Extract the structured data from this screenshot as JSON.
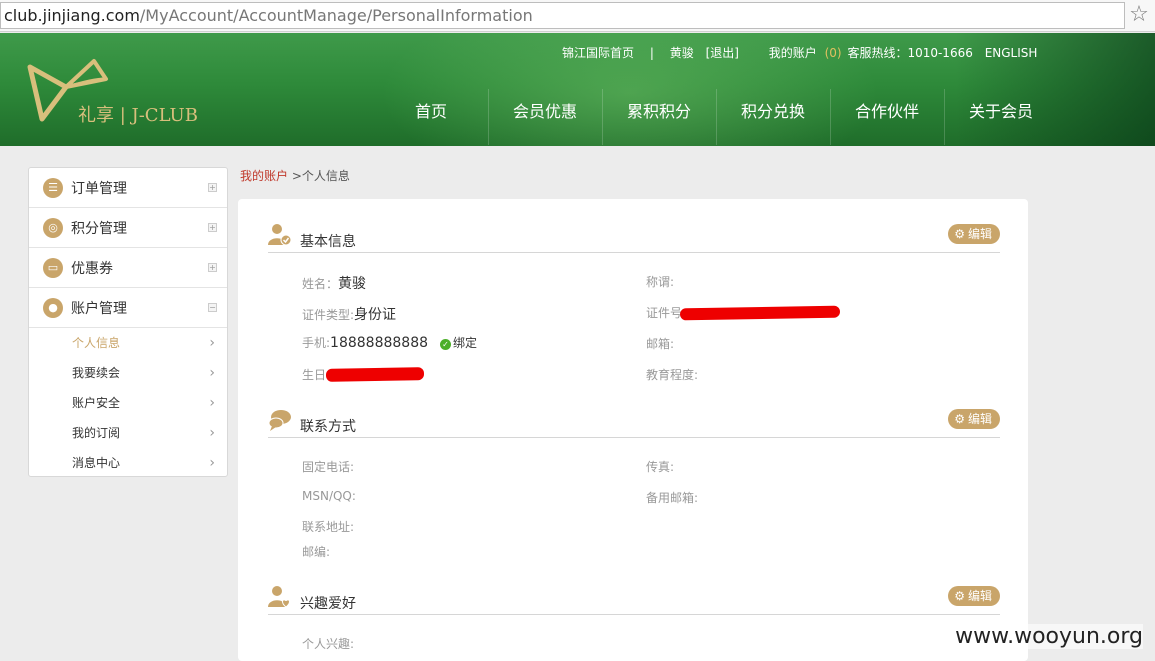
{
  "browser": {
    "url_host": "club.jinjiang.com",
    "url_path": "/MyAccount/AccountManage/PersonalInformation",
    "bookmark_icon": "star-icon"
  },
  "header": {
    "logo_text": "礼享 | J-CLUB",
    "top_links": {
      "home": "锦江国际首页",
      "separator": "|",
      "username": "黄骏",
      "logout": "[退出]",
      "my_account": "我的账户",
      "account_count": "(0)",
      "hotline": "客服热线：1010-1666",
      "english": "ENGLISH"
    },
    "nav": [
      "首页",
      "会员优惠",
      "累积积分",
      "积分兑换",
      "合作伙伴",
      "关于会员"
    ]
  },
  "sidebar": {
    "groups": [
      {
        "label": "订单管理",
        "icon": "list-icon",
        "toggle": "+"
      },
      {
        "label": "积分管理",
        "icon": "coins-icon",
        "toggle": "+"
      },
      {
        "label": "优惠券",
        "icon": "coupon-icon",
        "toggle": "+"
      },
      {
        "label": "账户管理",
        "icon": "user-icon",
        "toggle": "−"
      }
    ],
    "subitems": [
      "个人信息",
      "我要续会",
      "账户安全",
      "我的订阅",
      "消息中心"
    ],
    "active_subitem": "个人信息"
  },
  "breadcrumb": {
    "link": "我的账户",
    "separator": " >",
    "current": "个人信息"
  },
  "sections": {
    "edit_label": "编辑",
    "basic": {
      "title": "基本信息",
      "name_label": "姓名：",
      "name_value": "黄骏",
      "title_label": "称谓:",
      "id_type_label": "证件类型:",
      "id_type_value": "身份证",
      "id_number_label": "证件号",
      "phone_label": "手机:",
      "phone_value": "18888888888",
      "phone_bound": "绑定",
      "email_label": "邮箱:",
      "birthday_label": "生日",
      "education_label": "教育程度:"
    },
    "contact": {
      "title": "联系方式",
      "landline_label": "固定电话:",
      "fax_label": "传真:",
      "msn_label": "MSN/QQ:",
      "backup_email_label": "备用邮箱:",
      "address_label": "联系地址:",
      "postcode_label": "邮编:"
    },
    "hobbies": {
      "title": "兴趣爱好",
      "interests_label": "个人兴趣:"
    }
  },
  "watermark": "www.wooyun.org",
  "colors": {
    "header_green": "#2e8a3a",
    "gold": "#c9a56a",
    "breadcrumb_link": "#c0392b",
    "redaction": "#ee0000"
  }
}
